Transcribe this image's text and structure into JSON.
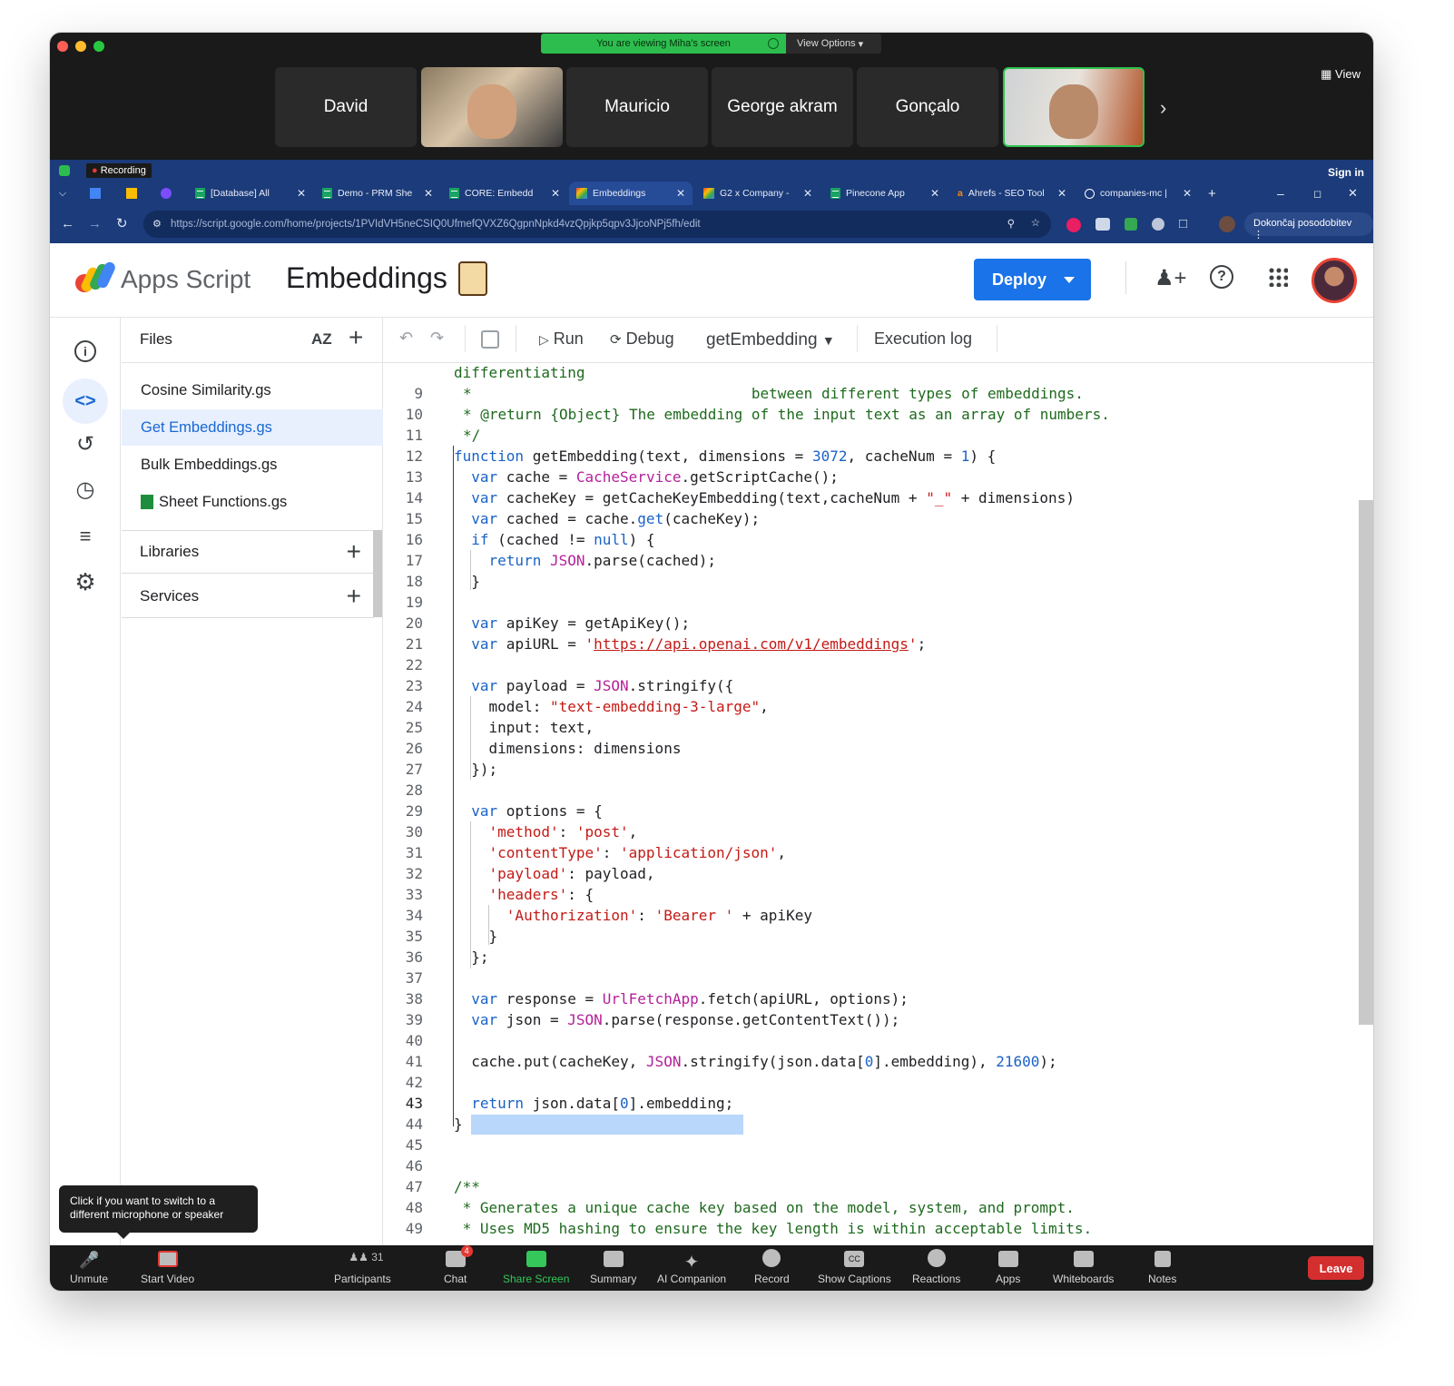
{
  "zoom": {
    "banner": {
      "viewing": "You are viewing Miha's screen",
      "view_options": "View Options"
    },
    "view_label": "View",
    "participants": [
      "David",
      "Mauricio",
      "George akram",
      "Gonçalo"
    ],
    "recording": "Recording",
    "sign_in": "Sign in",
    "tooltip": "Click if you want to switch to a different microphone or speaker",
    "toolbar": {
      "unmute": "Unmute",
      "start_video": "Start Video",
      "participants": "Participants",
      "participants_count": "31",
      "chat": "Chat",
      "chat_badge": "4",
      "share_screen": "Share Screen",
      "summary": "Summary",
      "ai_companion": "AI Companion",
      "record": "Record",
      "show_captions": "Show Captions",
      "reactions": "Reactions",
      "apps": "Apps",
      "whiteboards": "Whiteboards",
      "notes": "Notes",
      "leave": "Leave"
    }
  },
  "browser": {
    "tabs": [
      {
        "title": "[Database] All"
      },
      {
        "title": "Demo - PRM She"
      },
      {
        "title": "CORE: Embedd"
      },
      {
        "title": "Embeddings"
      },
      {
        "title": "G2 x Company - "
      },
      {
        "title": "Pinecone App"
      },
      {
        "title": "Ahrefs - SEO Tool"
      },
      {
        "title": "companies-mc | "
      }
    ],
    "url": "https://script.google.com/home/projects/1PVIdVH5neCSIQ0UfmefQVXZ6QgpnNpkd4vzQpjkp5qpv3JjcoNPj5fh/edit",
    "update_button": "Dokončaj posodobitev"
  },
  "app": {
    "product": "Apps Script",
    "project": "Embeddings",
    "deploy": "Deploy",
    "files_title": "Files",
    "sort_label": "AZ",
    "files": [
      {
        "name": "Cosine Similarity.gs"
      },
      {
        "name": "Get Embeddings.gs"
      },
      {
        "name": "Bulk Embeddings.gs"
      },
      {
        "name": "Sheet Functions.gs"
      }
    ],
    "libraries": "Libraries",
    "services": "Services",
    "toolbar": {
      "run": "Run",
      "debug": "Debug",
      "function": "getEmbedding",
      "execution_log": "Execution log"
    }
  },
  "code": {
    "line_numbers": [
      "",
      "9",
      "10",
      "11",
      "12",
      "13",
      "14",
      "15",
      "16",
      "17",
      "18",
      "19",
      "20",
      "21",
      "22",
      "23",
      "24",
      "25",
      "26",
      "27",
      "28",
      "29",
      "30",
      "31",
      "32",
      "33",
      "34",
      "35",
      "36",
      "37",
      "38",
      "39",
      "40",
      "41",
      "42",
      "43",
      "44",
      "45",
      "46",
      "47",
      "48",
      "49"
    ]
  },
  "colors": {
    "accent": "#1a73e8",
    "zoom_green": "#2dbd4e",
    "leave_red": "#d32f2f"
  }
}
